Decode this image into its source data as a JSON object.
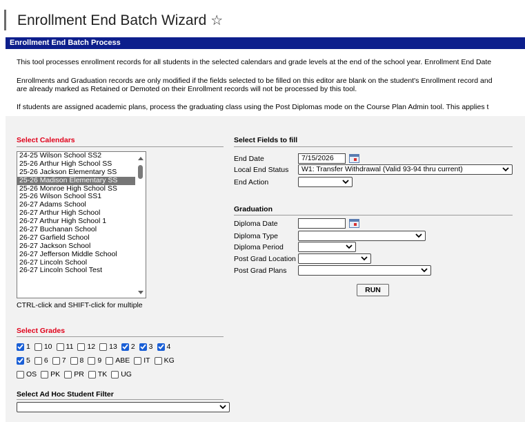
{
  "page": {
    "title": "Enrollment End Batch Wizard",
    "star_icon": "star-outline-icon",
    "section_header": "Enrollment End Batch Process"
  },
  "description": {
    "p1": "This tool processes enrollment records for all students in the selected calendars and grade levels at the end of the school year. Enrollment End Date",
    "p2a": "Enrollments and Graduation records are only modified if the fields selected to be filled on this editor are blank on the student's Enrollment record and",
    "p2b": "are already marked as Retained or Demoted on their Enrollment records will not be processed by this tool.",
    "p3": "If students are assigned academic plans, process the graduating class using the Post Diplomas mode on the Course Plan Admin tool. This applies t"
  },
  "calendars": {
    "label": "Select Calendars",
    "items": [
      "24-25 Wilson School SS2",
      "25-26 Arthur High School SS",
      "25-26 Jackson Elementary SS",
      "25-26 Madison Elementary SS",
      "25-26 Monroe High School SS",
      "25-26 Wilson School SS1",
      "26-27 Adams School",
      "26-27 Arthur High School",
      "26-27 Arthur High School 1",
      "26-27 Buchanan School",
      "26-27 Garfield School",
      "26-27 Jackson School",
      "26-27 Jefferson Middle School",
      "26-27 Lincoln School",
      "26-27 Lincoln School Test"
    ],
    "selected": "25-26 Madison Elementary SS",
    "hint": "CTRL-click and SHIFT-click for multiple"
  },
  "grades": {
    "label": "Select Grades",
    "rows": [
      [
        {
          "label": "1",
          "checked": true
        },
        {
          "label": "10",
          "checked": false
        },
        {
          "label": "11",
          "checked": false
        },
        {
          "label": "12",
          "checked": false
        },
        {
          "label": "13",
          "checked": false
        },
        {
          "label": "2",
          "checked": true
        },
        {
          "label": "3",
          "checked": true
        },
        {
          "label": "4",
          "checked": true
        }
      ],
      [
        {
          "label": "5",
          "checked": true
        },
        {
          "label": "6",
          "checked": false
        },
        {
          "label": "7",
          "checked": false
        },
        {
          "label": "8",
          "checked": false
        },
        {
          "label": "9",
          "checked": false
        },
        {
          "label": "ABE",
          "checked": false
        },
        {
          "label": "IT",
          "checked": false
        },
        {
          "label": "KG",
          "checked": false
        }
      ],
      [
        {
          "label": "OS",
          "checked": false
        },
        {
          "label": "PK",
          "checked": false
        },
        {
          "label": "PR",
          "checked": false
        },
        {
          "label": "TK",
          "checked": false
        },
        {
          "label": "UG",
          "checked": false
        }
      ]
    ]
  },
  "adhoc": {
    "label": "Select Ad Hoc Student Filter",
    "value": ""
  },
  "fields": {
    "label": "Select Fields to fill",
    "end_date_label": "End Date",
    "end_date_value": "7/15/2026",
    "local_end_status_label": "Local End Status",
    "local_end_status_value": "W1: Transfer Withdrawal (Valid 93-94 thru current)",
    "end_action_label": "End Action",
    "end_action_value": ""
  },
  "graduation": {
    "label": "Graduation",
    "diploma_date_label": "Diploma Date",
    "diploma_date_value": "",
    "diploma_type_label": "Diploma Type",
    "diploma_type_value": "",
    "diploma_period_label": "Diploma Period",
    "diploma_period_value": "",
    "post_grad_location_label": "Post Grad Location",
    "post_grad_location_value": "",
    "post_grad_plans_label": "Post Grad Plans",
    "post_grad_plans_value": ""
  },
  "run_label": "RUN",
  "colors": {
    "header_bg": "#0d1f8c",
    "required_label": "#e0001a",
    "checkbox_checked": "#1a5fd6",
    "selected_row": "#767676"
  }
}
